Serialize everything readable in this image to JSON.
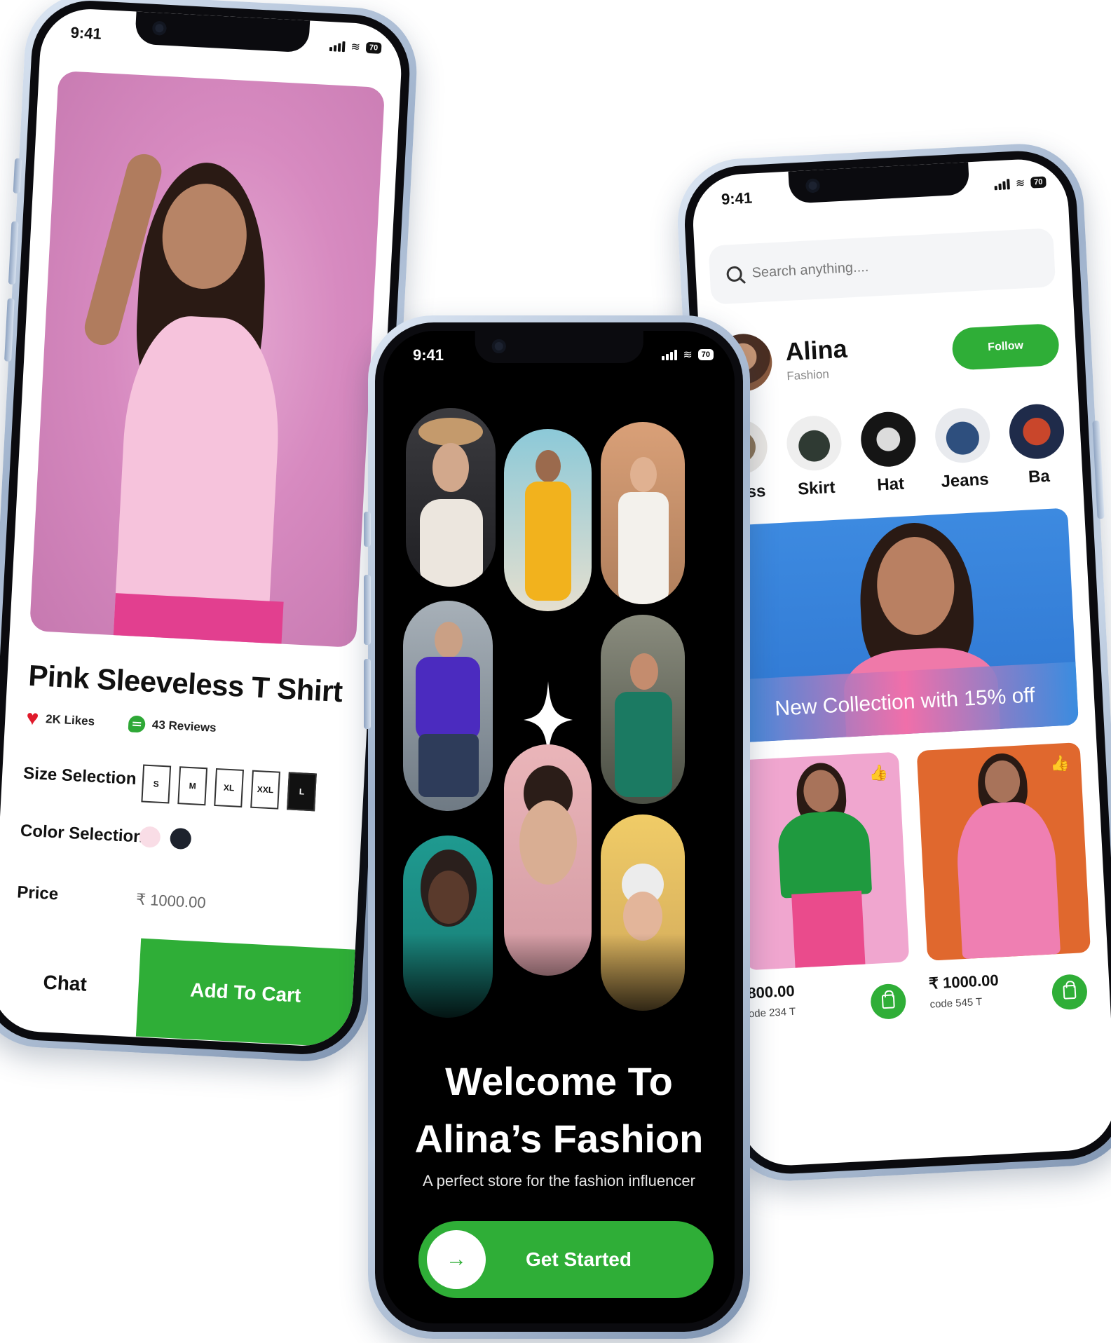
{
  "status": {
    "time": "9:41",
    "battery": "70"
  },
  "product_screen": {
    "title": "Pink Sleeveless T Shirt",
    "likes": "2K Likes",
    "reviews": "43 Reviews",
    "size_label": "Size Selection",
    "sizes": [
      "S",
      "M",
      "XL",
      "XXL",
      "L"
    ],
    "selected_size": "L",
    "color_label": "Color Selection",
    "colors": [
      "#f9dde6",
      "#1d222d"
    ],
    "price_label": "Price",
    "price": "₹ 1000.00",
    "chat_button": "Chat",
    "cart_button": "Add To Cart"
  },
  "welcome_screen": {
    "title": "Welcome To Alina’s Fashion",
    "tagline": "A perfect store for the fashion influencer",
    "cta": "Get Started",
    "arrow": "→"
  },
  "shop_screen": {
    "search_placeholder": "Search anything....",
    "profile_name": "Alina",
    "profile_sub": "Fashion",
    "follow_button": "Follow",
    "categories": [
      "Dress",
      "Skirt",
      "Hat",
      "Jeans",
      "Ba"
    ],
    "banner": "New Collection with 15% off",
    "products": [
      {
        "price": "800.00",
        "code": "ode 234 T"
      },
      {
        "price": "₹ 1000.00",
        "code": "code 545 T"
      }
    ],
    "like_icon": "👍"
  },
  "colors": {
    "accent_green": "#2fae37",
    "like_red": "#e01a2b"
  }
}
